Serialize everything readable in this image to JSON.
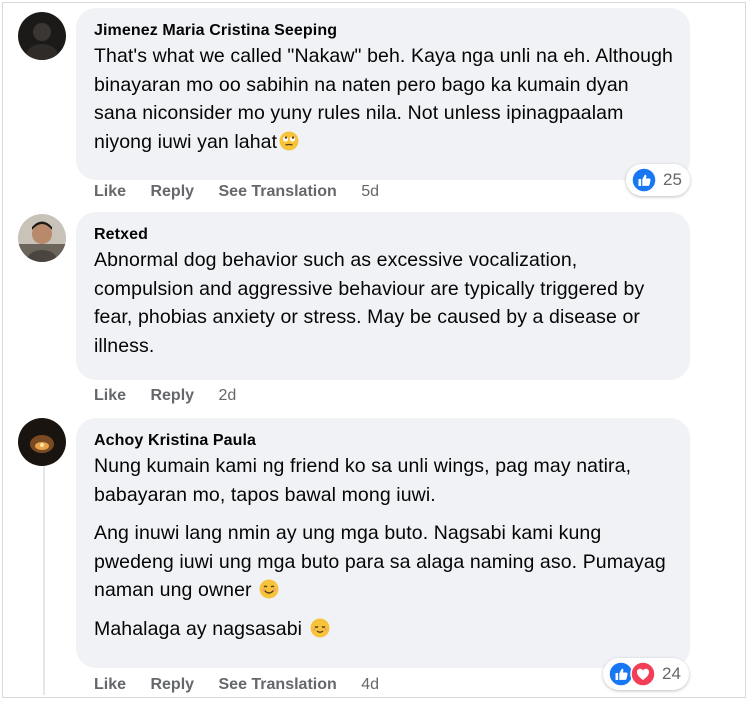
{
  "comments": [
    {
      "author": "Jimenez Maria Cristina Seeping",
      "text": "That's what we called \"Nakaw\" beh. Kaya nga unli na eh. Although binayaran mo oo sabihin na naten pero bago ka kumain dyan sana niconsider mo yuny rules nila. Not unless ipinagpaalam niyong iuwi yan lahat",
      "emoji": "rolling-eyes-emoji",
      "actions": {
        "like": "Like",
        "reply": "Reply",
        "translate": "See Translation",
        "time": "5d"
      },
      "reaction_count": "25",
      "reaction_icons": [
        "like-reaction-icon"
      ]
    },
    {
      "author": "Retxed",
      "text": "Abnormal dog behavior such as excessive vocalization, compulsion and aggressive behaviour are typically triggered by fear, phobias anxiety or stress. May be caused by a disease or illness.",
      "actions": {
        "like": "Like",
        "reply": "Reply",
        "time": "2d"
      }
    },
    {
      "author": "Achoy Kristina Paula",
      "paragraphs": [
        "Nung kumain kami ng friend ko sa unli wings, pag may natira, babayaran mo, tapos bawal mong iuwi.",
        "Ang inuwi lang nmin ay ung mga buto. Nagsabi kami kung pwedeng iuwi ung mga buto para sa alaga naming aso. Pumayag naman ung owner",
        "Mahalaga ay nagsasabi"
      ],
      "paragraph_emojis": [
        "",
        "smiling-emoji",
        "relieved-emoji"
      ],
      "actions": {
        "like": "Like",
        "reply": "Reply",
        "translate": "See Translation",
        "time": "4d"
      },
      "reaction_count": "24",
      "reaction_icons": [
        "like-reaction-icon",
        "love-reaction-icon"
      ]
    }
  ],
  "colors": {
    "bubble": "#f0f2f5",
    "secondary_text": "#65676b",
    "like_blue": "#1877f2",
    "love_red": "#f33e58"
  }
}
